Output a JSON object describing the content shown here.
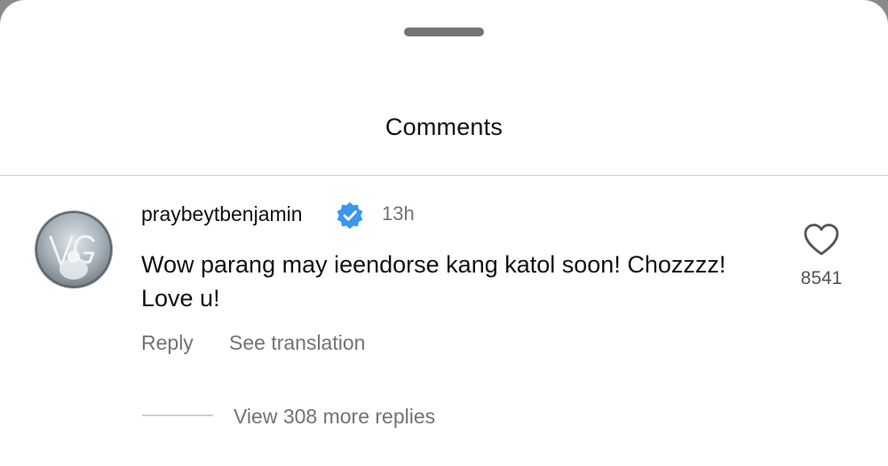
{
  "header": {
    "title": "Comments"
  },
  "comment": {
    "username": "praybeytbenjamin",
    "verified": true,
    "time": "13h",
    "text": "Wow parang may ieendorse kang katol soon! Chozzzz! Love u!",
    "reply_label": "Reply",
    "translate_label": "See translation",
    "like_count": "8541",
    "view_replies_label": "View 308 more replies"
  },
  "icons": {
    "verified": "verified-badge-icon",
    "like": "heart-icon",
    "drag": "drag-handle"
  },
  "colors": {
    "verified_blue": "#3897f0",
    "secondary_text": "#737373"
  }
}
